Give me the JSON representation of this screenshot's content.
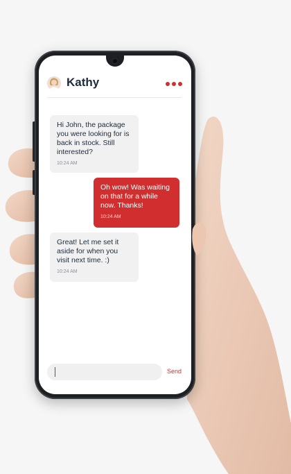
{
  "chat": {
    "contact_name": "Kathy",
    "avatar_icon": "user-avatar-icon",
    "more_icon": "more-dots-icon",
    "accent_color": "#d12f2f"
  },
  "messages": [
    {
      "direction": "incoming",
      "text": "Hi John, the package you were looking for is back in stock. Still interested?",
      "time": "10:24 AM"
    },
    {
      "direction": "outgoing",
      "text": "Oh wow! Was waiting on that for a while now. Thanks!",
      "time": "10:24 AM"
    },
    {
      "direction": "incoming",
      "text": "Great! Let me set it aside for when you visit next time. :)",
      "time": "10:24 AM"
    }
  ],
  "composer": {
    "value": "",
    "send_label": "Send"
  }
}
